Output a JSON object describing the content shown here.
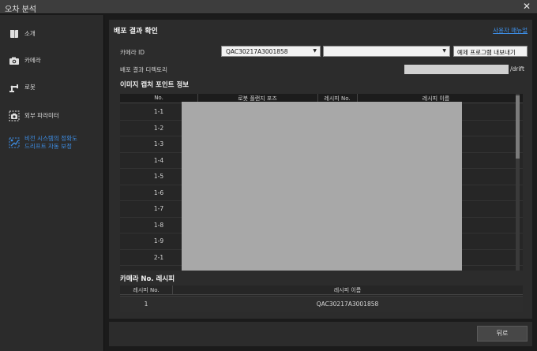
{
  "window": {
    "title": "오차 분석",
    "close": "✕"
  },
  "sidebar": {
    "items": [
      {
        "label": "소개",
        "icon": "book-icon",
        "active": false
      },
      {
        "label": "카메라",
        "icon": "camera-icon",
        "active": false
      },
      {
        "label": "로봇",
        "icon": "robot-arm-icon",
        "active": false
      },
      {
        "label": "외부 파라미터",
        "icon": "extrinsic-camera-icon",
        "active": false
      },
      {
        "label_line1": "비전 시스템의 정확도",
        "label_line2": "드리프트 자동 보정",
        "icon": "drift-correction-icon",
        "active": true
      }
    ]
  },
  "main": {
    "section_title": "배포 결과 확인",
    "manual_link": "사용자 매뉴얼",
    "camera_id_label": "카메라 ID",
    "camera_id_value": "QAC30217A3001858",
    "second_select_value": "",
    "export_button": "예제 프로그램 내보내기",
    "deploy_dir_label": "배포 결과 디렉토리",
    "deploy_dir_suffix": "/drift",
    "capture_section_title": "이미지 캡처 포인트 정보",
    "capture_table": {
      "headers": [
        "No.",
        "로봇 플랜지 포즈",
        "레시피 No.",
        "레시피 이름"
      ],
      "rows": [
        "1-1",
        "1-2",
        "1-3",
        "1-4",
        "1-5",
        "1-6",
        "1-7",
        "1-8",
        "1-9",
        "2-1"
      ]
    },
    "recipe_section_title": "카메라 No. 레시피",
    "recipe_table": {
      "headers": [
        "레시피 No.",
        "레시피 이름"
      ],
      "rows": [
        {
          "no": "1",
          "name": "QAC30217A3001858"
        }
      ]
    }
  },
  "footer": {
    "back_button": "뒤로"
  },
  "colors": {
    "accent": "#3d8ee6",
    "background": "#1b1b1b",
    "panel": "#2c2c2c"
  }
}
